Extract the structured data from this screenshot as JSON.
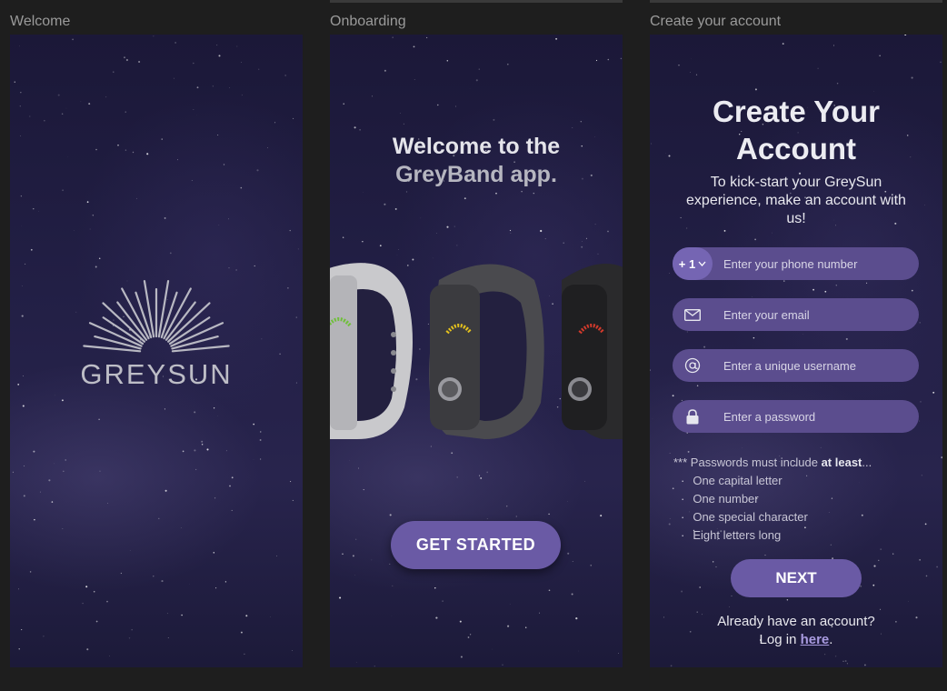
{
  "frames": [
    {
      "label": "Welcome"
    },
    {
      "label": "Onboarding"
    },
    {
      "label": "Create your account"
    }
  ],
  "welcome": {
    "logo_text": "GREYSUN"
  },
  "onboarding": {
    "title_line1": "Welcome to the",
    "title_line2": "GreyBand app.",
    "cta_label": "GET STARTED",
    "band_indicator_colors": [
      "#6fbf3a",
      "#e4c11d",
      "#d33a2c"
    ]
  },
  "create_account": {
    "title_line1": "Create Your",
    "title_line2": "Account",
    "subtitle": "To kick-start your GreySun experience, make an account with us!",
    "phone": {
      "country_code": "+ 1",
      "placeholder": "Enter your phone number"
    },
    "email": {
      "placeholder": "Enter your email",
      "icon": "envelope-icon"
    },
    "username": {
      "placeholder": "Enter a unique username",
      "icon": "at-sign-icon"
    },
    "password": {
      "placeholder": "Enter a password",
      "icon": "lock-icon"
    },
    "rules_intro_prefix": "*** Passwords must include ",
    "rules_intro_bold": "at least",
    "rules_intro_suffix": "...",
    "rules": [
      "One capital letter",
      "One number",
      "One special character",
      "Eight letters long"
    ],
    "next_label": "NEXT",
    "login_prompt": "Already have an account?",
    "login_prefix": "Log in ",
    "login_link": "here",
    "login_suffix": "."
  },
  "colors": {
    "accent": "#6a5aa5",
    "field_bg": "#5b4d8e",
    "background": "#1e1e1e",
    "link": "#a99be0"
  }
}
